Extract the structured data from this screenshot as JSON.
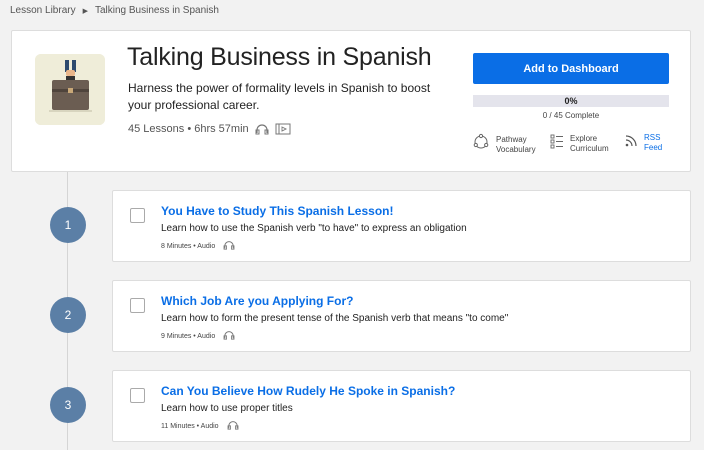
{
  "breadcrumb": {
    "root": "Lesson Library",
    "current": "Talking Business in Spanish"
  },
  "course": {
    "title": "Talking Business in Spanish",
    "description": "Harness the power of formality levels in Spanish to boost your professional career.",
    "meta": "45 Lessons • 6hrs 57min"
  },
  "actions": {
    "add_label": "Add to Dashboard",
    "progress_percent": "0%",
    "progress_fraction": 0,
    "progress_count": "0 / 45 Complete"
  },
  "tools": {
    "pathway": "Pathway\nVocabulary",
    "curriculum": "Explore\nCurriculum",
    "rss": "RSS\nFeed"
  },
  "lessons": [
    {
      "number": "1",
      "title": "You Have to Study This Spanish Lesson!",
      "desc": "Learn how to use the Spanish verb \"to have\" to express an obligation",
      "meta": "8 Minutes • Audio"
    },
    {
      "number": "2",
      "title": "Which Job Are you Applying For?",
      "desc": "Learn how to form the present tense of the Spanish verb that means \"to come\"",
      "meta": "9 Minutes • Audio"
    },
    {
      "number": "3",
      "title": "Can You Believe How Rudely He Spoke in Spanish?",
      "desc": "Learn how to use proper titles",
      "meta": "11 Minutes • Audio"
    }
  ],
  "colors": {
    "accent": "#0a6ee6",
    "badge": "#5b7fa6",
    "background": "#f2f2f2"
  }
}
